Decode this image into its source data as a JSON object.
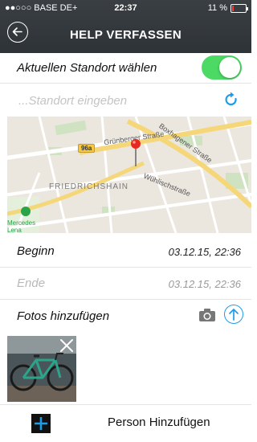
{
  "status_bar": {
    "carrier": "●●○○○ BASE DE+",
    "time": "22:37",
    "battery_text": "11 %",
    "battery_level": 0.11
  },
  "header": {
    "back_icon": "back-arrow-circle-icon",
    "title": "HELP VERFASSEN"
  },
  "location": {
    "toggle_label": "Aktuellen Standort wählen",
    "toggle_on": true,
    "input_placeholder": "...Standort eingeben",
    "refresh_icon": "refresh-icon"
  },
  "map": {
    "district": "FRIEDRICHSHAIN",
    "streets": [
      "Grünberger Straße",
      "Boxhagener Straße",
      "Wühlischstraße"
    ],
    "route_badge": "96a",
    "poi": [
      "Mercedes",
      "Lena"
    ],
    "pin_icon": "map-pin-icon"
  },
  "times": {
    "start_label": "Beginn",
    "start_value": "03.12.15, 22:36",
    "end_label": "Ende",
    "end_value": "03.12.15, 22:36"
  },
  "photos": {
    "label": "Fotos hinzufügen",
    "camera_icon": "camera-icon",
    "upload_icon": "upload-arrow-icon",
    "thumbnail_icon": "bicycle-photo",
    "remove_icon": "close-icon"
  },
  "person": {
    "add_icon": "plus-icon",
    "label": "Person Hinzufügen"
  },
  "colors": {
    "header_bg": "#34393d",
    "toggle_on": "#4cd964",
    "accent_blue": "#1e9be9",
    "battery_low": "#ff3b30"
  }
}
